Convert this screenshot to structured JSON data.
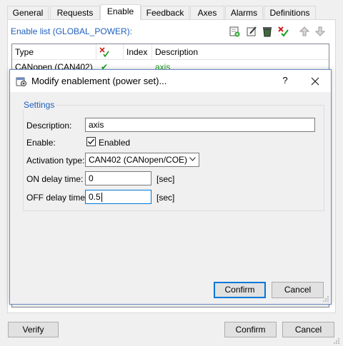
{
  "tabs": [
    {
      "label": "General"
    },
    {
      "label": "Requests"
    },
    {
      "label": "Enable",
      "active": true
    },
    {
      "label": "Feedback"
    },
    {
      "label": "Axes"
    },
    {
      "label": "Alarms"
    },
    {
      "label": "Definitions"
    }
  ],
  "enable_list": {
    "title": "Enable list (GLOBAL_POWER):",
    "toolbar_icons": [
      "add-icon",
      "edit-icon",
      "delete-icon",
      "check-icon",
      "move-up-icon",
      "move-down-icon"
    ],
    "columns": [
      "Type",
      "",
      "Index",
      "Description"
    ],
    "column_1_icon": "validate-icon",
    "rows": [
      {
        "type": "CANopen (CAN402)",
        "check": "✔",
        "index": "",
        "description": "axis"
      }
    ]
  },
  "footer": {
    "verify": "Verify",
    "confirm": "Confirm",
    "cancel": "Cancel"
  },
  "dialog": {
    "title": "Modify enablement (power set)...",
    "help": "?",
    "group_label": "Settings",
    "description_label": "Description:",
    "description_value": "axis",
    "enable_label": "Enable:",
    "enable_checked": true,
    "enable_text": "Enabled",
    "activation_label": "Activation type:",
    "activation_value": "CAN402 (CANopen/COE)",
    "on_delay_label": "ON delay time:",
    "on_delay_value": "0",
    "on_delay_unit": "[sec]",
    "off_delay_label": "OFF delay time:",
    "off_delay_value": "0.5",
    "off_delay_unit": "[sec]",
    "confirm": "Confirm",
    "cancel": "Cancel"
  },
  "colors": {
    "accent": "#0078d7",
    "link_blue": "#1f5fbf",
    "check_green": "#1a9b1a",
    "error_red": "#d11f1f"
  }
}
